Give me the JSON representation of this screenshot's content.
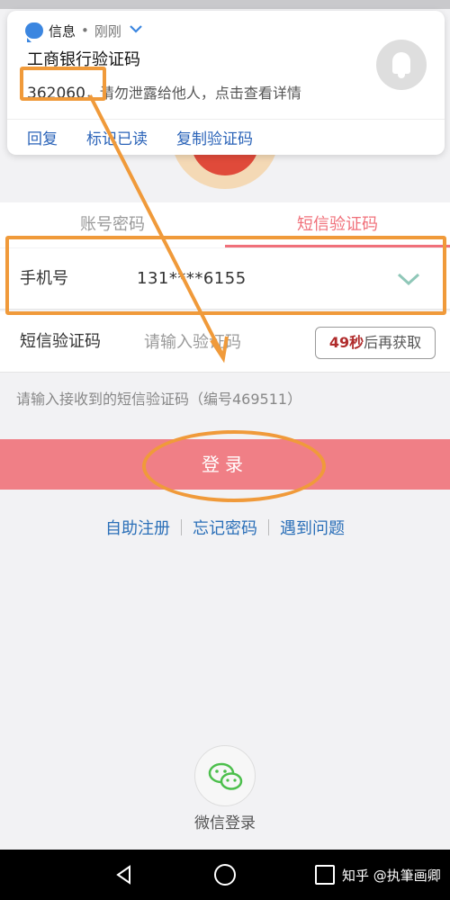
{
  "notification": {
    "app_name": "信息",
    "separator": "•",
    "time": "刚刚",
    "title": "工商银行验证码",
    "code": "362060",
    "body_rest": "，请勿泄露给他人，点击查看详情",
    "actions": [
      "回复",
      "标记已读",
      "复制验证码"
    ]
  },
  "tabs": {
    "account": "账号密码",
    "sms": "短信验证码"
  },
  "form": {
    "phone_label": "手机号",
    "phone_value": "131****6155",
    "sms_label": "短信验证码",
    "sms_placeholder": "请输入验证码",
    "resend_seconds": "49秒",
    "resend_suffix": "后再获取",
    "hint": "请输入接收到的短信验证码（编号469511）",
    "login": "登录"
  },
  "links": [
    "自助注册",
    "忘记密码",
    "遇到问题"
  ],
  "wechat": {
    "label": "微信登录"
  },
  "navbar": {
    "watermark": "知乎 @执筆画卿"
  },
  "colors": {
    "accent_pink": "#f07f86",
    "tab_active": "#f0707a",
    "link_blue": "#2a6fb8",
    "annotation_orange": "#f09a3a",
    "wechat_green": "#4cbf4c"
  },
  "icons": {
    "message": "message-bubble-icon",
    "bell": "bell-icon",
    "dropdown": "chevron-down-icon",
    "wechat": "wechat-icon",
    "back": "back-triangle-icon",
    "home": "home-circle-icon",
    "recent": "recent-square-icon"
  }
}
